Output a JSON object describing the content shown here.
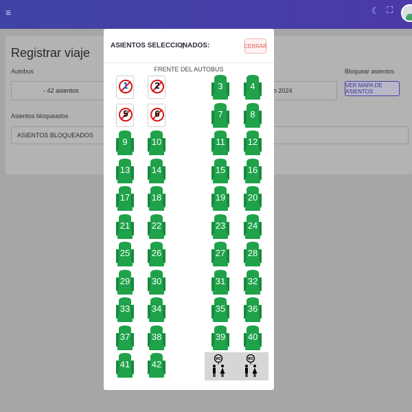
{
  "topbar": {
    "menu_icon": "≡",
    "moon_icon": "☾",
    "fullscreen_icon": "⛶"
  },
  "background": {
    "title": "Registrar viaje",
    "bus_label": "Autobus",
    "bus_value": "- 42 asientos",
    "date_value": "o 2024",
    "block_label": "Bloquear asientos",
    "map_button": "VER MAPA DE ASIENTOS",
    "blocked_label": "Asientos bloqueados",
    "blocked_placeholder": "ASIENTOS BLOQUEADOS"
  },
  "modal": {
    "title": "ASIENTOS SELECCIONADOS:",
    "count": "4",
    "close_label": "CERRAR",
    "front_label": "FRENTE DEL AUTOBUS"
  },
  "blocked_seats": [
    {
      "label": "1",
      "selected": true
    },
    {
      "label": "2",
      "selected": false
    },
    {
      "label": "5",
      "selected": false
    },
    {
      "label": "6",
      "selected": false
    }
  ],
  "seats": [
    "3",
    "4",
    "7",
    "8",
    "9",
    "10",
    "11",
    "12",
    "13",
    "14",
    "15",
    "16",
    "17",
    "18",
    "19",
    "20",
    "21",
    "22",
    "23",
    "24",
    "25",
    "26",
    "27",
    "28",
    "29",
    "30",
    "31",
    "32",
    "33",
    "34",
    "35",
    "36",
    "37",
    "38",
    "39",
    "40",
    "41",
    "42"
  ],
  "colors": {
    "seat": "#1fa24a",
    "seat_dark": "#178a3c",
    "header": "#4040a4",
    "blocked": "#d41414"
  },
  "restroom_icon": "restroom-icon"
}
